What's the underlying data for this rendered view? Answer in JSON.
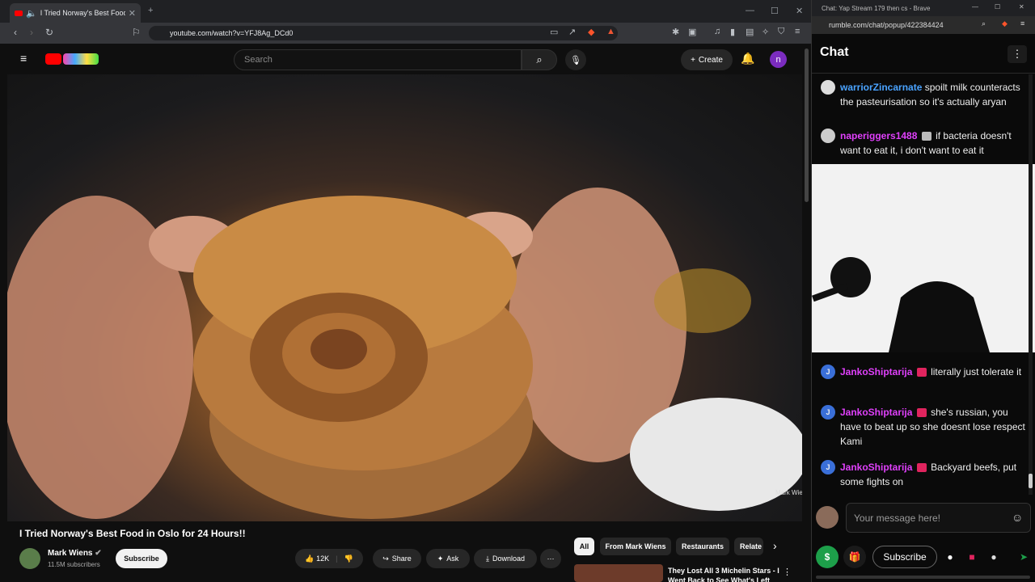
{
  "left_browser": {
    "tab_title": "I Tried Norway's Best Food in",
    "url": "youtube.com/watch?v=YFJ8Ag_DCd0"
  },
  "youtube": {
    "search_placeholder": "Search",
    "create_label": "Create",
    "avatar_initial": "n",
    "video_title": "I Tried Norway's Best Food in Oslo for 24 Hours!!",
    "watermark": "Mark Wiens",
    "channel_name": "Mark Wiens",
    "channel_subs": "11.5M subscribers",
    "subscribe_label": "Subscribe",
    "like_count": "12K",
    "share_label": "Share",
    "ask_label": "Ask",
    "download_label": "Download",
    "chips": [
      "All",
      "From Mark Wiens",
      "Restaurants",
      "Relate"
    ],
    "rec_title": "They Lost All 3 Michelin Stars - I Went Back to See What's Left"
  },
  "chat_window": {
    "title_bar": "Chat: Yap Stream 179 then cs - Brave",
    "url": "rumble.com/chat/popup/422384424",
    "heading": "Chat",
    "messages": [
      {
        "user": "warriorZincarnate",
        "text": "spoilt milk counteracts the pasteurisation so it's actually aryan",
        "color": "#4aa3ff"
      },
      {
        "user": "naperiggers1488",
        "text": "if bacteria doesn't want to eat it, i don't want to eat it",
        "color": "#e040fb"
      },
      {
        "user": "JankoShiptarija",
        "text": "literally just tolerate it",
        "color": "#e040fb"
      },
      {
        "user": "JankoShiptarija",
        "text": "she's russian, you have to beat up so she doesnt lose respect Kami",
        "color": "#e040fb"
      },
      {
        "user": "JankoShiptarija",
        "text": "Backyard beefs, put some fights on",
        "color": "#e040fb"
      }
    ],
    "input_placeholder": "Your message here!",
    "subscribe_label": "Subscribe",
    "avatar_letter": "J"
  }
}
